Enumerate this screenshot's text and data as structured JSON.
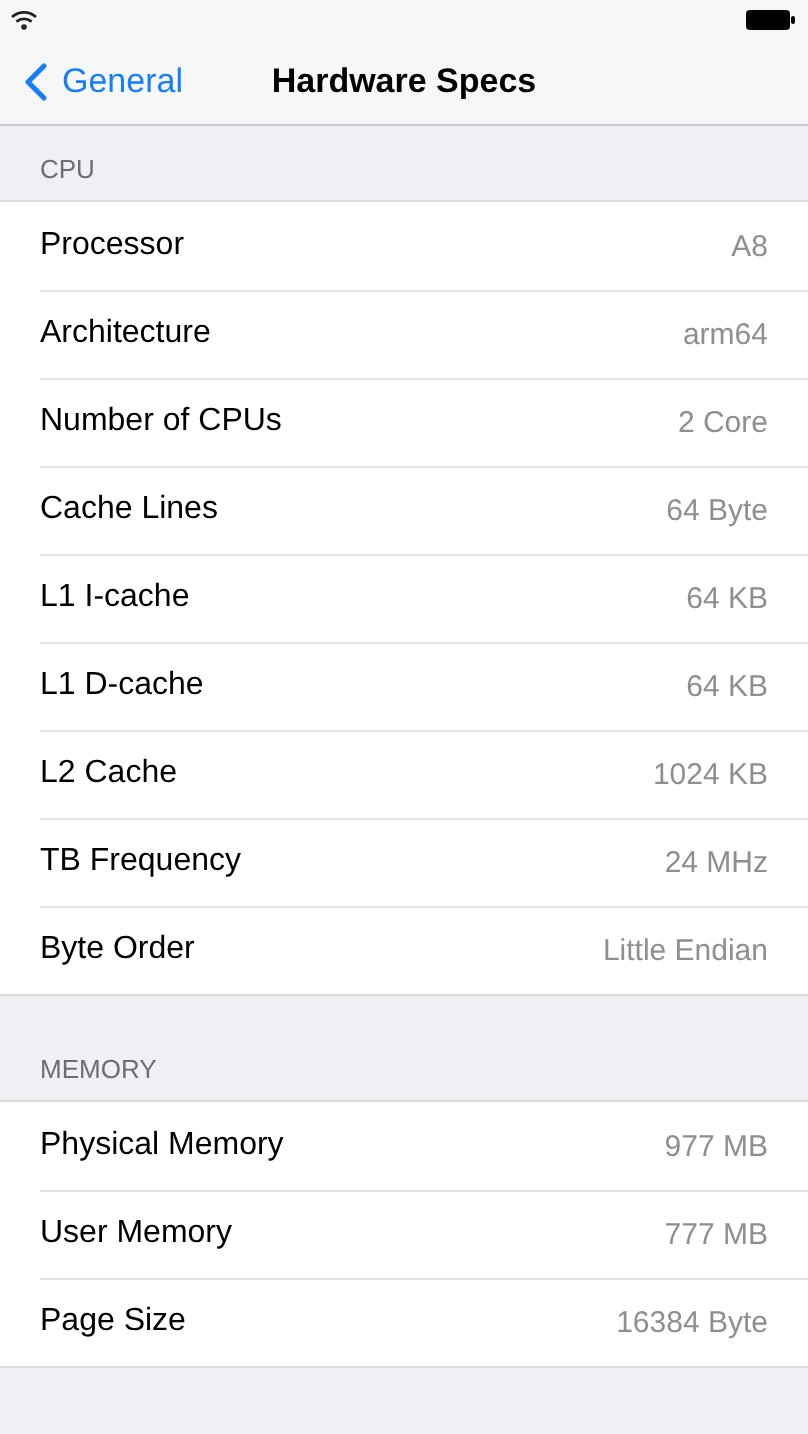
{
  "nav_bar": {
    "back_label": "General",
    "title": "Hardware Specs"
  },
  "sections": [
    {
      "header": "CPU",
      "rows": [
        {
          "label": "Processor",
          "value": "A8"
        },
        {
          "label": "Architecture",
          "value": "arm64"
        },
        {
          "label": "Number of CPUs",
          "value": "2 Core"
        },
        {
          "label": "Cache Lines",
          "value": "64 Byte"
        },
        {
          "label": "L1 I-cache",
          "value": "64 KB"
        },
        {
          "label": "L1 D-cache",
          "value": "64 KB"
        },
        {
          "label": "L2 Cache",
          "value": "1024 KB"
        },
        {
          "label": "TB Frequency",
          "value": "24 MHz"
        },
        {
          "label": "Byte Order",
          "value": "Little Endian"
        }
      ]
    },
    {
      "header": "MEMORY",
      "rows": [
        {
          "label": "Physical Memory",
          "value": "977 MB"
        },
        {
          "label": "User Memory",
          "value": "777 MB"
        },
        {
          "label": "Page Size",
          "value": "16384 Byte"
        }
      ]
    }
  ]
}
